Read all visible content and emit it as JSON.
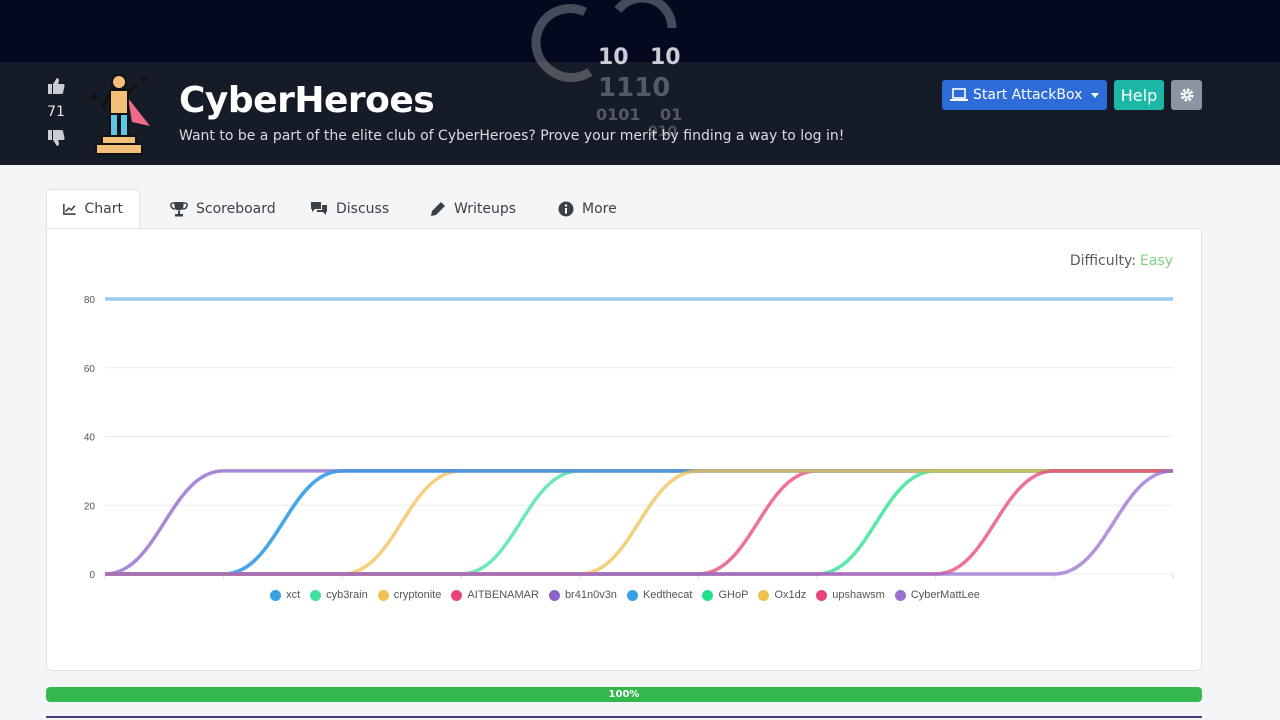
{
  "header": {
    "title": "CyberHeroes",
    "description": "Want to be a part of the elite club of CyberHeroes? Prove your merit by finding a way to log in!",
    "votes": "71",
    "deco_digits": [
      "10",
      "10",
      "1110",
      "0101",
      "01",
      "010"
    ]
  },
  "buttons": {
    "attackbox": "Start AttackBox",
    "help": "Help"
  },
  "tabs": [
    {
      "label": "Chart",
      "icon": "chart-line-icon",
      "active": true
    },
    {
      "label": "Scoreboard",
      "icon": "trophy-icon",
      "active": false
    },
    {
      "label": "Discuss",
      "icon": "comments-icon",
      "active": false
    },
    {
      "label": "Writeups",
      "icon": "pen-icon",
      "active": false
    },
    {
      "label": "More",
      "icon": "info-circle-icon",
      "active": false
    }
  ],
  "difficulty": {
    "label": "Difficulty:",
    "value": "Easy",
    "color": "#7ed37a"
  },
  "progress": {
    "value": 100,
    "label": "100%",
    "color": "#32b84b"
  },
  "chart_data": {
    "type": "line",
    "ylim": [
      0,
      80
    ],
    "yticks": [
      0,
      20,
      40,
      60,
      80
    ],
    "grid": true,
    "legend": "bottom",
    "x_steps": 9,
    "reference_line": {
      "value": 80,
      "color": "#9ccbf0"
    },
    "series": [
      {
        "name": "xct",
        "color": "#3aa0e6",
        "step_at": 2
      },
      {
        "name": "cyb3rain",
        "color": "#3fe0a0",
        "step_at": 4
      },
      {
        "name": "cryptonite",
        "color": "#f0c050",
        "step_at": 3
      },
      {
        "name": "AITBENAMAR",
        "color": "#e8447a",
        "step_at": 6
      },
      {
        "name": "br41n0v3n",
        "color": "#8a63c9",
        "step_at": 1
      },
      {
        "name": "Kedthecat",
        "color": "#3aa0e6",
        "step_at": 2
      },
      {
        "name": "GHoP",
        "color": "#22e08a",
        "step_at": 7
      },
      {
        "name": "Ox1dz",
        "color": "#f0c050",
        "step_at": 5
      },
      {
        "name": "upshawsm",
        "color": "#e8447a",
        "step_at": 8
      },
      {
        "name": "CyberMattLee",
        "color": "#9870d0",
        "step_at": 9
      }
    ],
    "series_value": 30
  }
}
